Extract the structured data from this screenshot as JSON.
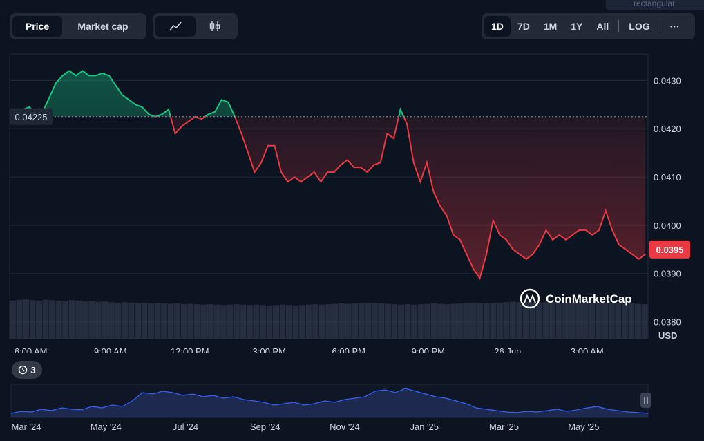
{
  "top_chip_text": "rectangular",
  "metric_toggle": {
    "price_label": "Price",
    "market_cap_label": "Market cap"
  },
  "chart_style_toggle": {
    "line_icon": "line-chart-icon",
    "candle_icon": "candlestick-icon"
  },
  "range_buttons": [
    "1D",
    "7D",
    "1M",
    "1Y",
    "All",
    "LOG"
  ],
  "active_range": "1D",
  "more_label": "···",
  "watermark": "CoinMarketCap",
  "history_count": "3",
  "colors": {
    "up": "#16c784",
    "down": "#ea3943",
    "background": "#0d1421",
    "baseline": "#8a93a6",
    "nav_line": "#3861fb"
  },
  "chart_data": {
    "type": "line",
    "currency_label": "USD",
    "baseline_label": "0.04225",
    "baseline_value": 0.04225,
    "current_label": "0.0395",
    "current_value": 0.0395,
    "y_ticks": [
      "0.0430",
      "0.0420",
      "0.0410",
      "0.0400",
      "0.0390",
      "0.0380"
    ],
    "y_tick_values": [
      0.043,
      0.042,
      0.041,
      0.04,
      0.039,
      0.038
    ],
    "ylim": [
      0.03765,
      0.04355
    ],
    "x_ticks": [
      "6:00 AM",
      "9:00 AM",
      "12:00 PM",
      "3:00 PM",
      "6:00 PM",
      "9:00 PM",
      "26 Jun",
      "3:00 AM"
    ],
    "x_tick_hours": [
      6,
      9,
      12,
      15,
      18,
      21,
      24,
      27
    ],
    "xlim_hours": [
      5.2,
      29.3
    ],
    "series": [
      {
        "hours": [
          5.2,
          5.45,
          5.7,
          5.95,
          6.2,
          6.45,
          6.7,
          6.95,
          7.2,
          7.45,
          7.7,
          7.95,
          8.2,
          8.45,
          8.7,
          8.95,
          9.2,
          9.45,
          9.7,
          9.95,
          10.2,
          10.45,
          10.7,
          10.95,
          11.2,
          11.45,
          11.7,
          11.95,
          12.2,
          12.45,
          12.7,
          12.95,
          13.2,
          13.45,
          13.7,
          13.95,
          14.2,
          14.45,
          14.7,
          14.95,
          15.2,
          15.45,
          15.7,
          15.95,
          16.2,
          16.45,
          16.7,
          16.95,
          17.2,
          17.45,
          17.7,
          17.95,
          18.2,
          18.45,
          18.7,
          18.95,
          19.2,
          19.45,
          19.7,
          19.95,
          20.2,
          20.45,
          20.7,
          20.95,
          21.2,
          21.45,
          21.7,
          21.95,
          22.2,
          22.45,
          22.7,
          22.95,
          23.2,
          23.45,
          23.7,
          23.95,
          24.2,
          24.45,
          24.7,
          24.95,
          25.2,
          25.45,
          25.7,
          25.95,
          26.2,
          26.45,
          26.7,
          26.95,
          27.2,
          27.45,
          27.7,
          27.95,
          28.2,
          28.45,
          28.7,
          28.95,
          29.2
        ],
        "values": [
          0.04235,
          0.04238,
          0.0424,
          0.04245,
          0.04225,
          0.04235,
          0.04265,
          0.04295,
          0.0431,
          0.0432,
          0.0431,
          0.0432,
          0.0431,
          0.0431,
          0.04315,
          0.0431,
          0.0429,
          0.0427,
          0.0426,
          0.0425,
          0.04245,
          0.0423,
          0.04225,
          0.0423,
          0.0424,
          0.0419,
          0.04205,
          0.04215,
          0.04225,
          0.0422,
          0.0423,
          0.04235,
          0.0426,
          0.04255,
          0.04225,
          0.0419,
          0.0415,
          0.0411,
          0.0413,
          0.04165,
          0.04165,
          0.0411,
          0.0409,
          0.041,
          0.0409,
          0.041,
          0.0411,
          0.0409,
          0.0411,
          0.0411,
          0.04125,
          0.04135,
          0.0412,
          0.0412,
          0.0411,
          0.04125,
          0.0413,
          0.0419,
          0.0418,
          0.0424,
          0.0421,
          0.0413,
          0.0409,
          0.0413,
          0.0407,
          0.0404,
          0.0402,
          0.0398,
          0.0397,
          0.0394,
          0.0391,
          0.0389,
          0.0394,
          0.0401,
          0.0398,
          0.0397,
          0.0395,
          0.0394,
          0.0393,
          0.0394,
          0.0396,
          0.0399,
          0.0397,
          0.0398,
          0.0397,
          0.0398,
          0.0399,
          0.0399,
          0.0398,
          0.0399,
          0.0403,
          0.0399,
          0.0396,
          0.0395,
          0.0394,
          0.0393,
          0.0394
        ]
      }
    ],
    "volume_relative": [
      0.95,
      0.97,
      0.98,
      0.96,
      0.95,
      0.97,
      0.96,
      0.95,
      0.94,
      0.96,
      0.95,
      0.93,
      0.94,
      0.92,
      0.93,
      0.91,
      0.9,
      0.91,
      0.9,
      0.89,
      0.9,
      0.88,
      0.89,
      0.88,
      0.87,
      0.88,
      0.86,
      0.87,
      0.86,
      0.85,
      0.86,
      0.85,
      0.84,
      0.85,
      0.86,
      0.85,
      0.84,
      0.85,
      0.84,
      0.83,
      0.84,
      0.85,
      0.84,
      0.83,
      0.84,
      0.85,
      0.86,
      0.85,
      0.86,
      0.87,
      0.88,
      0.87,
      0.88,
      0.89,
      0.9,
      0.89,
      0.88,
      0.87,
      0.86,
      0.85,
      0.86,
      0.85,
      0.86,
      0.87,
      0.88,
      0.87,
      0.86,
      0.87,
      0.88,
      0.89,
      0.9,
      0.89,
      0.88,
      0.89,
      0.9,
      0.91,
      0.92,
      0.91,
      0.92,
      0.91,
      0.9,
      0.91,
      0.9,
      0.89,
      0.9,
      0.89,
      0.9,
      0.89,
      0.88,
      0.89,
      0.9,
      0.89,
      0.88,
      0.87,
      0.88,
      0.87,
      0.86
    ],
    "navigator": {
      "x_ticks": [
        "Mar '24",
        "May '24",
        "Jul '24",
        "Sep '24",
        "Nov '24",
        "Jan '25",
        "Mar '25",
        "May '25"
      ],
      "values_relative": [
        0.15,
        0.22,
        0.2,
        0.3,
        0.25,
        0.35,
        0.3,
        0.28,
        0.4,
        0.35,
        0.45,
        0.4,
        0.6,
        0.9,
        0.85,
        0.95,
        0.9,
        0.8,
        0.85,
        0.75,
        0.8,
        0.7,
        0.75,
        0.65,
        0.6,
        0.55,
        0.45,
        0.5,
        0.55,
        0.45,
        0.5,
        0.6,
        0.55,
        0.65,
        0.7,
        0.75,
        0.95,
        1.0,
        0.9,
        1.05,
        0.95,
        0.85,
        0.75,
        0.7,
        0.6,
        0.5,
        0.35,
        0.3,
        0.25,
        0.2,
        0.18,
        0.22,
        0.2,
        0.25,
        0.3,
        0.22,
        0.28,
        0.35,
        0.4,
        0.3,
        0.25,
        0.2,
        0.18,
        0.15
      ]
    }
  }
}
